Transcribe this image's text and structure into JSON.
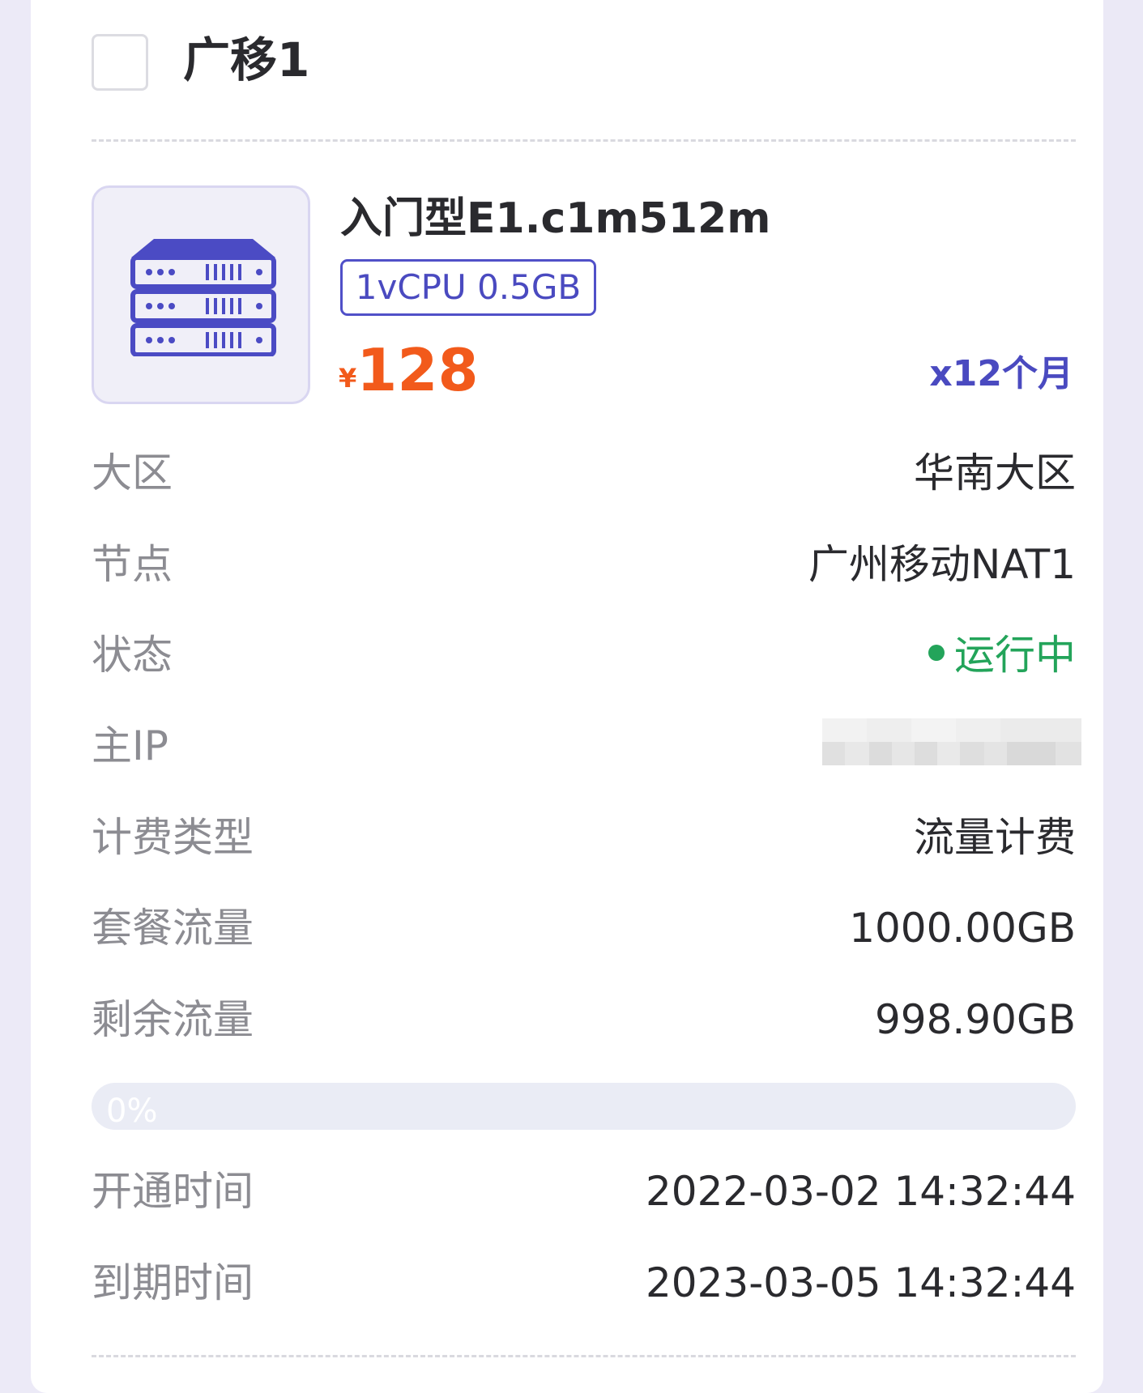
{
  "server": {
    "name": "广移1",
    "selected": false
  },
  "plan": {
    "name": "入门型E1.c1m512m",
    "spec": "1vCPU 0.5GB",
    "price_currency": "¥",
    "price": "128",
    "period": "x12个月",
    "icon": "server-rack-icon"
  },
  "details": {
    "region_label": "大区",
    "region_value": "华南大区",
    "node_label": "节点",
    "node_value": "广州移动NAT1",
    "status_label": "状态",
    "status_value": "运行中",
    "ip_label": "主IP",
    "billing_label": "计费类型",
    "billing_value": "流量计费",
    "traffic_label": "套餐流量",
    "traffic_value": "1000.00GB",
    "remaining_label": "剩余流量",
    "remaining_value": "998.90GB",
    "opened_label": "开通时间",
    "opened_value": "2022-03-02 14:32:44",
    "expire_label": "到期时间",
    "expire_value": "2023-03-05 14:32:44"
  },
  "usage": {
    "percent_text": "0%",
    "percent_value": 0
  },
  "colors": {
    "accent": "#5050c8",
    "price": "#f25a1b",
    "status_running": "#23a45a"
  }
}
